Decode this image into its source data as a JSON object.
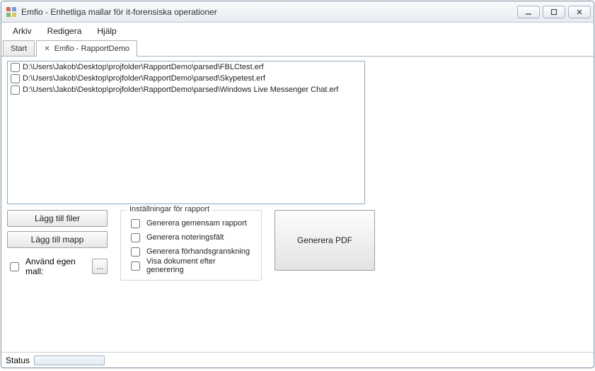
{
  "window": {
    "title": "Emfio - Enhetliga mallar för it-forensiska operationer"
  },
  "menubar": {
    "items": [
      "Arkiv",
      "Redigera",
      "Hjälp"
    ]
  },
  "tabs": [
    {
      "label": "Start",
      "active": false,
      "closable": false
    },
    {
      "label": "Emfio - RapportDemo",
      "active": true,
      "closable": true
    }
  ],
  "file_list": {
    "items": [
      {
        "path": "D:\\Users\\Jakob\\Desktop\\projfolder\\RapportDemo\\parsed\\FBLCtest.erf",
        "checked": false
      },
      {
        "path": "D:\\Users\\Jakob\\Desktop\\projfolder\\RapportDemo\\parsed\\Skypetest.erf",
        "checked": false
      },
      {
        "path": "D:\\Users\\Jakob\\Desktop\\projfolder\\RapportDemo\\parsed\\Windows Live Messenger Chat.erf",
        "checked": false
      }
    ]
  },
  "buttons": {
    "add_files": "Lägg till filer",
    "add_folder": "Lägg till mapp",
    "use_own_template": "Använd egen mall:",
    "browse": "...",
    "generate_pdf": "Generera PDF"
  },
  "report_settings": {
    "legend": "Inställningar för rapport",
    "options": [
      "Generera gemensam rapport",
      "Generera noteringsfält",
      "Generera förhandsgranskning",
      "Visa dokument efter generering"
    ]
  },
  "status": {
    "label": "Status"
  }
}
